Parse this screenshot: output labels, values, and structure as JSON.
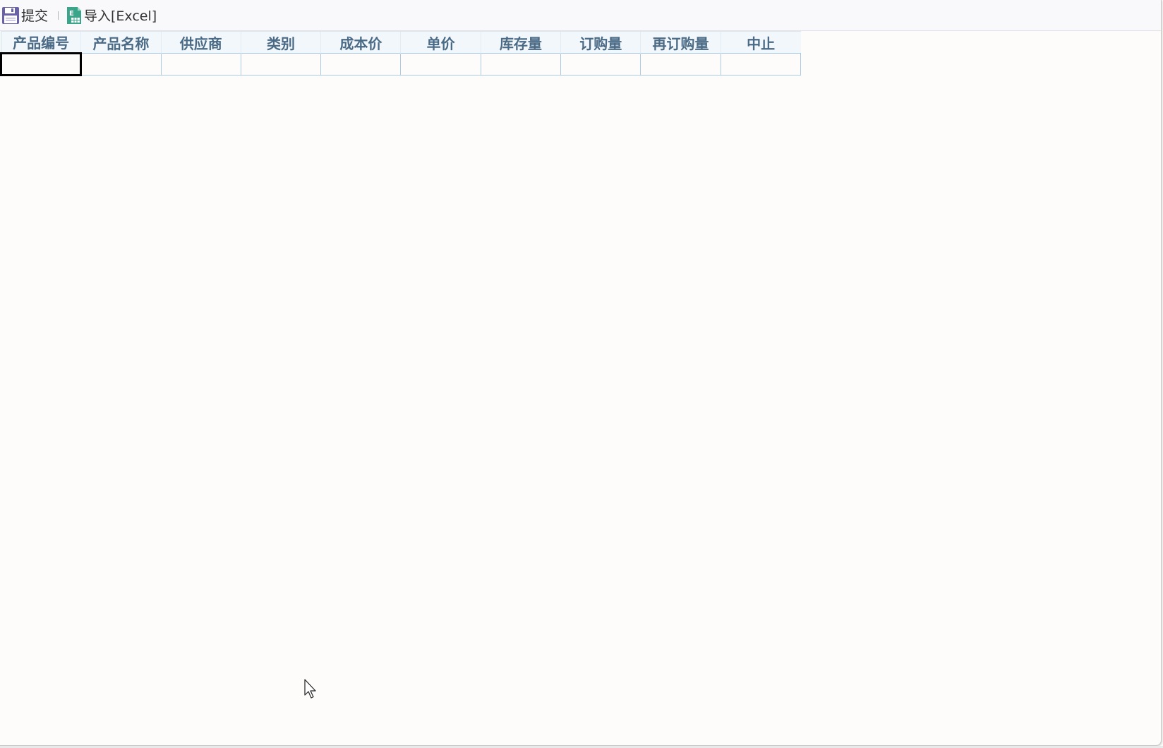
{
  "toolbar": {
    "submit_label": "提交",
    "import_label": "导入[Excel]",
    "submit_icon": "save-icon",
    "import_icon": "excel-icon"
  },
  "grid": {
    "columns": [
      "产品编号",
      "产品名称",
      "供应商",
      "类别",
      "成本价",
      "单价",
      "库存量",
      "订购量",
      "再订购量",
      "中止"
    ],
    "rows": [
      [
        "",
        "",
        "",
        "",
        "",
        "",
        "",
        "",
        "",
        ""
      ]
    ]
  },
  "colors": {
    "header_text": "#4a6a85",
    "header_bg": "#f2f7fb",
    "cell_border": "#a8cbe3",
    "active_cell_border": "#000000",
    "save_icon": "#6a62a8",
    "excel_icon": "#3aa58a"
  }
}
